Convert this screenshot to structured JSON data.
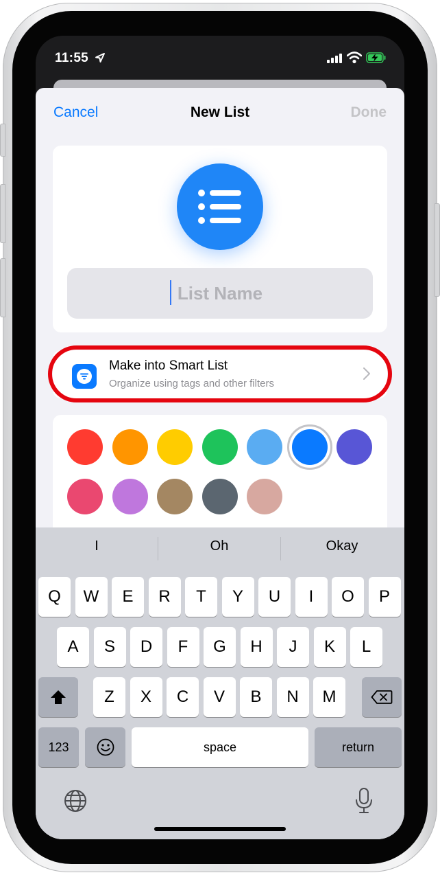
{
  "status_bar": {
    "time": "11:55"
  },
  "nav": {
    "cancel": "Cancel",
    "title": "New List",
    "done": "Done"
  },
  "name_field": {
    "placeholder": "List Name"
  },
  "smart_list": {
    "title": "Make into Smart List",
    "subtitle": "Organize using tags and other filters"
  },
  "colors": {
    "row1": [
      "#ff3b30",
      "#ff9500",
      "#ffcc00",
      "#1ec35b",
      "#5aacf2",
      "#0a7aff",
      "#5856d6"
    ],
    "row2": [
      "#ea4870",
      "#bf77dd",
      "#a48762",
      "#5b6670",
      "#d7a8a0"
    ],
    "selected": "#0a7aff"
  },
  "keyboard": {
    "suggestions": [
      "I",
      "Oh",
      "Okay"
    ],
    "row1": [
      "Q",
      "W",
      "E",
      "R",
      "T",
      "Y",
      "U",
      "I",
      "O",
      "P"
    ],
    "row2": [
      "A",
      "S",
      "D",
      "F",
      "G",
      "H",
      "J",
      "K",
      "L"
    ],
    "row3": [
      "Z",
      "X",
      "C",
      "V",
      "B",
      "N",
      "M"
    ],
    "numbers": "123",
    "space": "space",
    "return": "return"
  },
  "icons": [
    "location-arrow-icon",
    "cellular-signal-icon",
    "wifi-icon",
    "battery-charging-icon",
    "list-bullets-icon",
    "smart-list-filter-icon",
    "chevron-right-icon",
    "shift-icon",
    "backspace-icon",
    "emoji-icon",
    "globe-icon",
    "microphone-icon"
  ]
}
